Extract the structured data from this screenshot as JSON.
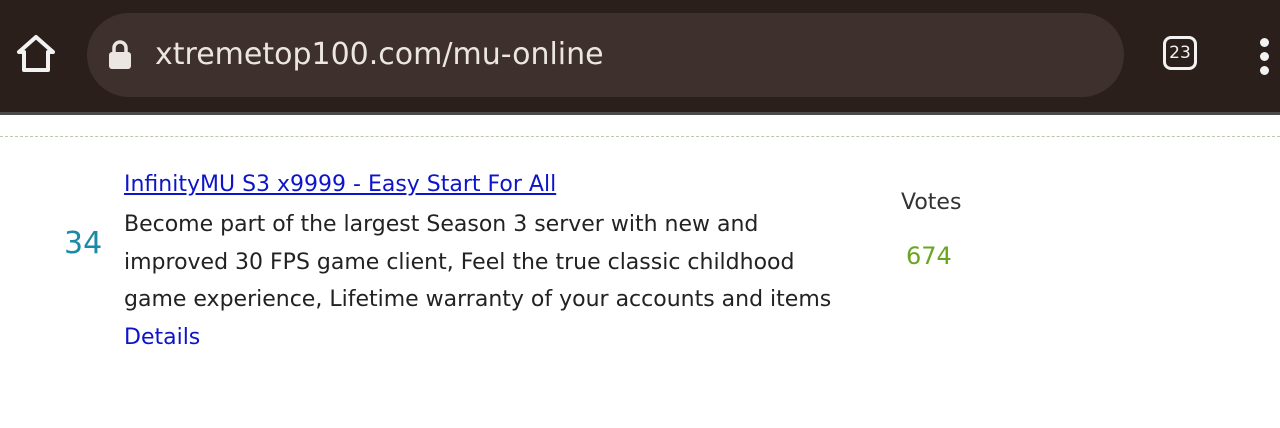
{
  "browser": {
    "url": "xtremetop100.com/mu-online",
    "tab_count": "23",
    "icons": {
      "home": "home-icon",
      "lock": "lock-icon",
      "tabs": "tabs-counter-icon",
      "menu": "more-vert-icon"
    },
    "colors": {
      "toolbar": "#2b1f1c",
      "url_bar": "#3e302c"
    }
  },
  "listing": {
    "rank": "34",
    "title": "InfinityMU S3 x9999 - Easy Start For All",
    "description": "Become part of the largest Season 3 server with new and improved 30 FPS game client, Feel the true classic childhood game experience, Lifetime warranty of your accounts and items",
    "details_label": "Details",
    "votes_label": "Votes",
    "votes_value": "674",
    "colors": {
      "rank": "#1a8aa6",
      "link": "#0d14c9",
      "votes_value": "#6aa520"
    }
  }
}
